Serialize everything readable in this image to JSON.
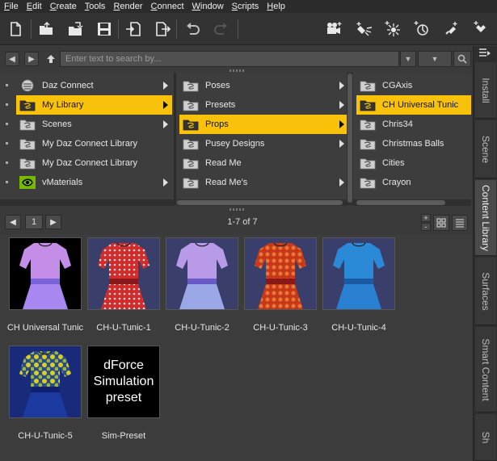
{
  "menu": [
    "File",
    "Edit",
    "Create",
    "Tools",
    "Render",
    "Connect",
    "Window",
    "Scripts",
    "Help"
  ],
  "menu_underline": [
    "F",
    "E",
    "C",
    "T",
    "R",
    "C",
    "W",
    "S",
    "H"
  ],
  "toolbar_icons": [
    "new-file-icon",
    "open-file-icon",
    "merge-file-icon",
    "save-icon",
    "import-icon",
    "export-icon",
    "undo-icon",
    "redo-icon",
    "camera-icon",
    "spotlight-icon",
    "point-light-icon",
    "distant-light-icon",
    "linear-light-icon",
    "more-icon"
  ],
  "search": {
    "placeholder": "Enter text to search by..."
  },
  "column1": [
    {
      "label": "Daz Connect",
      "selected": false,
      "has_children": true,
      "icon": "daz-connect-icon"
    },
    {
      "label": "My Library",
      "selected": true,
      "has_children": true,
      "icon": "folder-icon"
    },
    {
      "label": "Scenes",
      "selected": false,
      "has_children": true,
      "icon": "folder-icon"
    },
    {
      "label": "My Daz Connect Library",
      "selected": false,
      "has_children": false,
      "icon": "folder-icon"
    },
    {
      "label": "My Daz Connect Library",
      "selected": false,
      "has_children": false,
      "icon": "folder-icon"
    },
    {
      "label": "vMaterials",
      "selected": false,
      "has_children": true,
      "icon": "nvidia-icon"
    }
  ],
  "column2": [
    {
      "label": "Poses",
      "selected": false,
      "has_children": true
    },
    {
      "label": "Presets",
      "selected": false,
      "has_children": true
    },
    {
      "label": "Props",
      "selected": true,
      "has_children": true
    },
    {
      "label": "Pusey Designs",
      "selected": false,
      "has_children": true
    },
    {
      "label": "Read Me",
      "selected": false,
      "has_children": false
    },
    {
      "label": "Read Me's",
      "selected": false,
      "has_children": true
    }
  ],
  "column3": [
    {
      "label": "CGAxis",
      "selected": false
    },
    {
      "label": "CH Universal Tunic",
      "selected": true
    },
    {
      "label": "Chris34",
      "selected": false
    },
    {
      "label": "Christmas Balls",
      "selected": false
    },
    {
      "label": "Cities",
      "selected": false
    },
    {
      "label": "Crayon",
      "selected": false
    }
  ],
  "pager": {
    "page": "1",
    "count": "1-7 of 7"
  },
  "items": [
    {
      "label": "CH Universal Tunic",
      "style": "purple-dark"
    },
    {
      "label": "CH-U-Tunic-1",
      "style": "red-dots"
    },
    {
      "label": "CH-U-Tunic-2",
      "style": "purple-blue"
    },
    {
      "label": "CH-U-Tunic-3",
      "style": "red-pattern"
    },
    {
      "label": "CH-U-Tunic-4",
      "style": "blue"
    },
    {
      "label": "CH-U-Tunic-5",
      "style": "yellow-pattern"
    },
    {
      "label": "Sim-Preset",
      "style": "text",
      "tile_text": [
        "dForce",
        "Simulation",
        "preset"
      ]
    }
  ],
  "side_tabs": [
    {
      "label": "Install",
      "active": false
    },
    {
      "label": "Scene",
      "active": false
    },
    {
      "label": "Content Library",
      "active": true
    },
    {
      "label": "Surfaces",
      "active": false
    },
    {
      "label": "Smart Content",
      "active": false
    },
    {
      "label": "Sh",
      "active": false
    }
  ],
  "colors": {
    "accent": "#f9c20a",
    "panel": "#3c3c3c",
    "menubar": "#2b2b2b"
  }
}
